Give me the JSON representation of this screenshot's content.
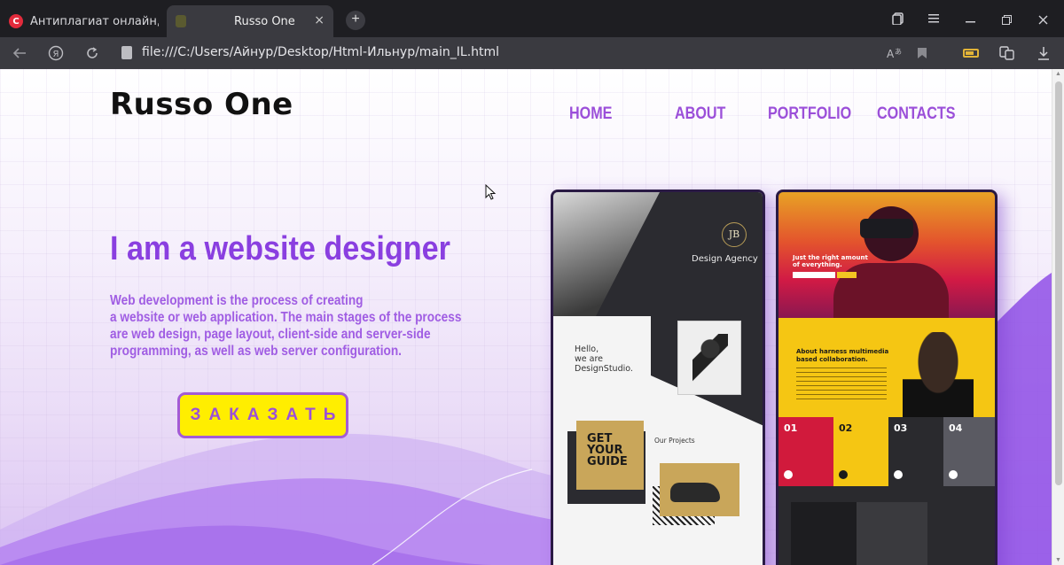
{
  "browser": {
    "tabs": [
      {
        "title": "Антиплагиат онлайн, про",
        "favicon": "С"
      },
      {
        "title": "Russo One",
        "favicon": ""
      }
    ],
    "url": "file:///C:/Users/Айнур/Desktop/Html-Ильнур/main_IL.html",
    "new_tab_label": "+",
    "close_label": "×"
  },
  "page": {
    "logo": "Russo One",
    "nav": {
      "home": "HOME",
      "about": "ABOUT",
      "portfolio": "PORTFOLIO",
      "contacts": "CONTACTS"
    },
    "hero_title": "I am a website designer",
    "hero_text": [
      "Web development is the process of creating",
      "a website or web application. The main stages of the process",
      "are web design, page layout, client-side and server-side",
      "programming, as well as web server configuration."
    ],
    "order_button": "ЗАКАЗАТЬ"
  },
  "portfolio": {
    "card1": {
      "badge": "JB",
      "agency": "Design Agency",
      "hello": [
        "Hello,",
        "we are",
        "DesignStudio."
      ],
      "guide": [
        "GET",
        "YOUR",
        "GUIDE"
      ],
      "projects_label": "Our Projects"
    },
    "card2": {
      "hero_text": [
        "Just the right amount",
        "of everything."
      ],
      "section_title": [
        "About harness multimedia",
        "based collaboration."
      ],
      "columns": [
        "01",
        "02",
        "03",
        "04"
      ]
    }
  },
  "colors": {
    "accent_purple": "#9b4fd9",
    "button_yellow": "#ffee00"
  }
}
